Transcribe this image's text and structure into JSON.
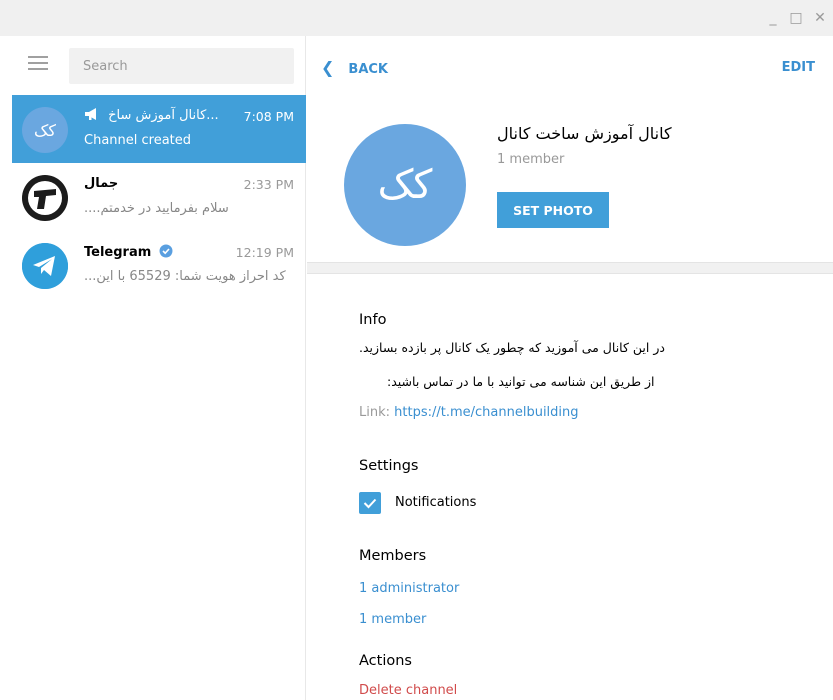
{
  "window": {
    "minimize_glyph": "_",
    "maximize_glyph": "□",
    "close_glyph": "✕"
  },
  "sidebar": {
    "search_placeholder": "Search",
    "chats": [
      {
        "name": "کانال آموزش ساخ...",
        "time": "7:08 PM",
        "preview": "Channel created",
        "avatar_text": "کک",
        "avatar_color": "#6aa7e0",
        "icon": "megaphone-icon",
        "active": true
      },
      {
        "name": "جمال",
        "time": "2:33 PM",
        "preview": "سلام  بفرمایید در خدمتم....",
        "icon": "logo-avatar-icon",
        "active": false
      },
      {
        "name": "Telegram",
        "time": "12:19 PM",
        "preview": "کد احراز هویت شما: 65529 با این...",
        "icon": "telegram-icon",
        "badge_icon": "verified-badge-icon",
        "avatar_color": "#2f9fdb",
        "active": false
      }
    ]
  },
  "header": {
    "back_label": "BACK",
    "edit_label": "EDIT"
  },
  "profile": {
    "name": "کانال آموزش ساخت کانال",
    "members_text": "1 member",
    "avatar_text": "کک",
    "set_photo_label": "SET PHOTO",
    "avatar_color": "#6aa7e0"
  },
  "info": {
    "title": "Info",
    "description_line1": "در این کانال می آموزید که چطور یک کانال پر بازده بسازید.",
    "description_line2": "از طریق این شناسه می توانید با ما در تماس باشید:",
    "link_label": "Link: ",
    "link_url": "https://t.me/channelbuilding"
  },
  "settings": {
    "title": "Settings",
    "notifications_label": "Notifications",
    "notifications_checked": true
  },
  "members": {
    "title": "Members",
    "administrators": "1 administrator",
    "members": "1 member"
  },
  "actions": {
    "title": "Actions",
    "delete_channel": "Delete channel"
  },
  "colors": {
    "accent": "#419fd9",
    "link": "#3a8fd0",
    "danger": "#d14b4b"
  }
}
